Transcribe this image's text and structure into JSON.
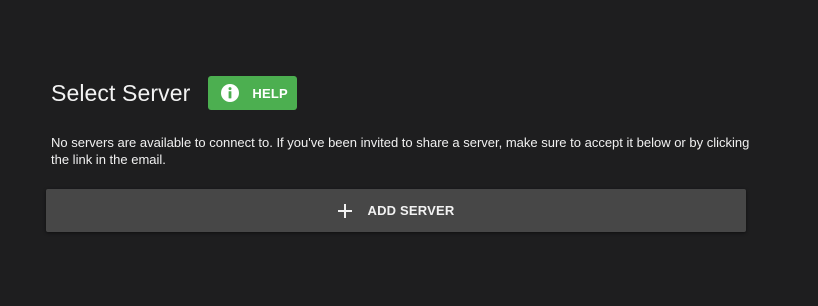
{
  "header": {
    "title": "Select Server",
    "help_label": "HELP"
  },
  "message": {
    "text": "No servers are available to connect to. If you've been invited to share a server, make sure to accept it below or by clicking the link in the email."
  },
  "actions": {
    "add_server_label": "ADD SERVER"
  },
  "icons": {
    "help": "info-icon",
    "add": "plus-icon"
  },
  "colors": {
    "background": "#1e1e1f",
    "help_button": "#4caf50",
    "add_server_button": "#474747",
    "text": "#f2f2f2"
  }
}
